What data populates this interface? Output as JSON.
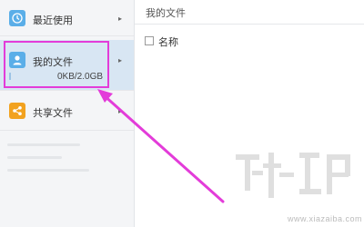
{
  "sidebar": {
    "items": [
      {
        "label": "最近使用",
        "icon": "clock-icon"
      },
      {
        "label": "我的文件",
        "icon": "user-icon",
        "storage": "0KB/2.0GB",
        "storage_used_fraction": 0.0
      },
      {
        "label": "共享文件",
        "icon": "share-icon"
      }
    ]
  },
  "content": {
    "breadcrumb": "我的文件",
    "column_name": "名称"
  },
  "watermark": {
    "url": "www.xiazaiba.com"
  },
  "colors": {
    "accent_blue": "#5aaee8",
    "share_orange": "#f2a21f",
    "selected_bg": "#d8e6f3",
    "annotation_magenta": "#e33cd9"
  }
}
